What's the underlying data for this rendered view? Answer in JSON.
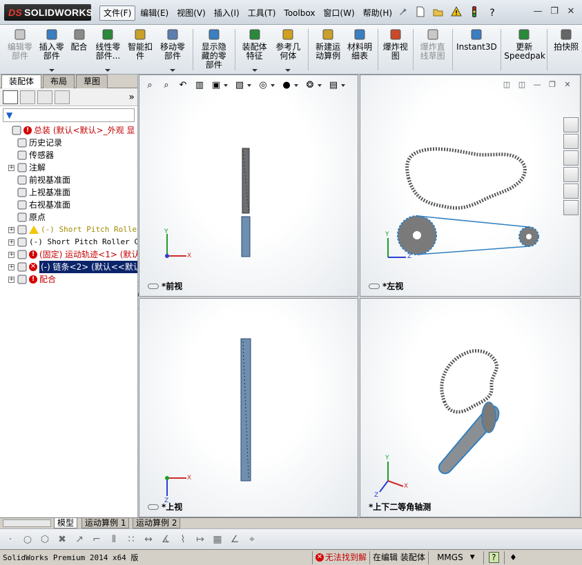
{
  "app": {
    "brand_prefix": "DS",
    "brand": "SOLIDWORKS",
    "menus": [
      "文件(F)",
      "编辑(E)",
      "视图(V)",
      "插入(I)",
      "工具(T)",
      "Toolbox",
      "窗口(W)",
      "帮助(H)"
    ],
    "active_menu_index": 0
  },
  "quick_access": [
    "pin-icon",
    "new-document-icon",
    "open-icon",
    "rebuild-warning-icon",
    "traffic-light-icon",
    "help-icon"
  ],
  "command_toolbar": [
    {
      "label": "编辑零\n部件",
      "icon": "edit-component-icon",
      "disabled": true,
      "dropdown": false
    },
    {
      "label": "插入零\n部件",
      "icon": "insert-component-icon",
      "disabled": false,
      "dropdown": true
    },
    {
      "label": "配合",
      "icon": "mate-icon",
      "disabled": false,
      "dropdown": false
    },
    {
      "label": "线性零\n部件...",
      "icon": "linear-pattern-icon",
      "disabled": false,
      "dropdown": true
    },
    {
      "label": "智能扣\n件",
      "icon": "smart-fastener-icon",
      "disabled": false,
      "dropdown": false
    },
    {
      "label": "移动零\n部件",
      "icon": "move-component-icon",
      "disabled": false,
      "dropdown": true
    },
    {
      "label": "显示隐\n藏的零\n部件",
      "icon": "show-hidden-icon",
      "disabled": false,
      "dropdown": false
    },
    {
      "label": "装配体\n特征",
      "icon": "assembly-feature-icon",
      "disabled": false,
      "dropdown": true
    },
    {
      "label": "参考几\n何体",
      "icon": "reference-geometry-icon",
      "disabled": false,
      "dropdown": true
    },
    {
      "label": "新建运\n动算例",
      "icon": "new-motion-study-icon",
      "disabled": false,
      "dropdown": false
    },
    {
      "label": "材料明\n细表",
      "icon": "bill-of-materials-icon",
      "disabled": false,
      "dropdown": false
    },
    {
      "label": "爆炸视\n图",
      "icon": "exploded-view-icon",
      "disabled": false,
      "dropdown": false
    },
    {
      "label": "爆炸直\n线草图",
      "icon": "explode-line-sketch-icon",
      "disabled": true,
      "dropdown": false
    },
    {
      "label": "Instant3D",
      "icon": "instant3d-icon",
      "disabled": false,
      "dropdown": false
    },
    {
      "label": "更新\nSpeedpak",
      "icon": "speedpak-icon",
      "disabled": false,
      "dropdown": false
    },
    {
      "label": "拍快照",
      "icon": "snapshot-icon",
      "disabled": false,
      "dropdown": false
    }
  ],
  "panel_tabs": [
    "装配体",
    "布局",
    "草图"
  ],
  "active_panel_tab": 0,
  "feature_tree": [
    {
      "text": "总装  (默认<默认>_外观 显",
      "icon": "assembly-icon",
      "status": "error",
      "color": "red",
      "expand": "none"
    },
    {
      "text": "历史记录",
      "icon": "history-icon",
      "status": "",
      "color": "",
      "expand": "none"
    },
    {
      "text": "传感器",
      "icon": "sensor-icon",
      "status": "",
      "color": "",
      "expand": "none"
    },
    {
      "text": "注解",
      "icon": "annotation-icon",
      "status": "",
      "color": "",
      "expand": "plus"
    },
    {
      "text": "前视基准面",
      "icon": "plane-icon",
      "status": "",
      "color": "",
      "expand": "none"
    },
    {
      "text": "上视基准面",
      "icon": "plane-icon",
      "status": "",
      "color": "",
      "expand": "none"
    },
    {
      "text": "右视基准面",
      "icon": "plane-icon",
      "status": "",
      "color": "",
      "expand": "none"
    },
    {
      "text": "原点",
      "icon": "origin-icon",
      "status": "",
      "color": "",
      "expand": "none"
    },
    {
      "text": "(-) Short Pitch Roller",
      "icon": "part-icon",
      "status": "warning",
      "color": "olive",
      "expand": "plus",
      "mono": true
    },
    {
      "text": "(-) Short Pitch Roller Cha",
      "icon": "part-icon",
      "status": "",
      "color": "",
      "expand": "plus",
      "mono": true
    },
    {
      "text": "(固定) 运动轨迹<1> (默认",
      "icon": "part-icon",
      "status": "error",
      "color": "red",
      "expand": "plus"
    },
    {
      "text": "(-) 链条<2> (默认<<默认",
      "icon": "chain-pattern-icon",
      "status": "error-x",
      "color": "",
      "expand": "plus",
      "selected": true
    },
    {
      "text": "配合",
      "icon": "mates-icon",
      "status": "error",
      "color": "red",
      "expand": "plus"
    }
  ],
  "view_tools": [
    "zoom-fit-icon",
    "zoom-area-icon",
    "previous-view-icon",
    "section-view-icon",
    "view-orientation-icon",
    "display-style-icon",
    "hide-show-items-icon",
    "edit-appearance-icon",
    "apply-scene-icon",
    "view-settings-icon"
  ],
  "viewports": [
    {
      "label": "*前视"
    },
    {
      "label": "*左视"
    },
    {
      "label": "*上视"
    },
    {
      "label": "*上下二等角轴测"
    }
  ],
  "axis_labels": {
    "x": "X",
    "y": "Y",
    "z": "Z"
  },
  "task_pane": [
    "home-icon",
    "design-library-icon",
    "file-explorer-icon",
    "view-palette-icon",
    "appearances-icon",
    "custom-properties-icon"
  ],
  "bottom_tabs": [
    "模型",
    "运动算例 1",
    "运动算例 2"
  ],
  "active_bottom_tab": 0,
  "sketch_toolbar": [
    "point-icon",
    "circle-icon",
    "polygon-icon",
    "trim-icon",
    "convert-icon",
    "offset-icon",
    "mirror-icon",
    "linear-sketch-pattern-icon",
    "move-entities-icon",
    "display-relations-icon",
    "rapid-sketch-icon",
    "smart-dimension-icon",
    "grid-icon",
    "angle-icon",
    "quick-snaps-icon"
  ],
  "status": {
    "product": "SolidWorks Premium 2014 x64 版",
    "error": "无法找到解",
    "mode": "在编辑 装配体",
    "units": "MMGS",
    "help": "?"
  },
  "colors": {
    "error_red": "#c40000",
    "selected_bg": "#0a246a",
    "chain_outline": "#2f7fc1",
    "x_axis": "#d12a2a",
    "y_axis": "#1a9e2a",
    "z_axis": "#2a3fd1"
  }
}
